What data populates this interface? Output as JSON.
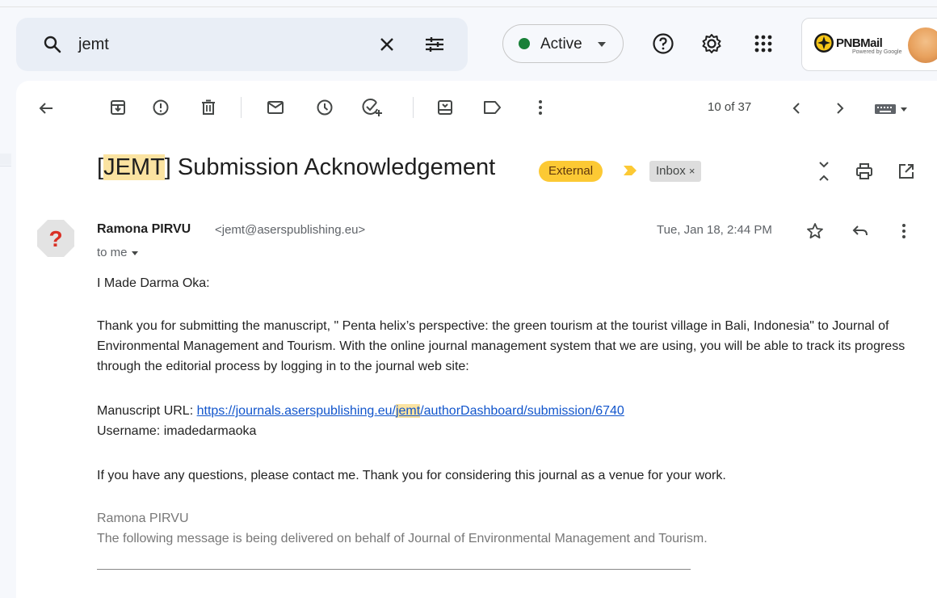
{
  "search": {
    "query": "jemt"
  },
  "status": {
    "label": "Active"
  },
  "brand": {
    "logo_text": "PNBMail",
    "powered_text": "Powered by Google"
  },
  "toolbar": {
    "pager": "10 of 37"
  },
  "email": {
    "subject_tag": "JEMT",
    "subject_rest": " Submission Acknowledgement",
    "external_label": "External",
    "inbox_label": "Inbox",
    "sender_name": "Ramona PIRVU",
    "sender_email": "<jemt@aserspublishing.eu>",
    "to_label": "to me",
    "date": "Tue, Jan 18, 2:44 PM",
    "greeting": "I Made Darma Oka:",
    "para1": "Thank you for submitting the manuscript, \" Penta helix’s perspective: the green tourism at the tourist village in Bali, Indonesia\" to Journal of Environmental Management and Tourism. With the online journal management system that we are using, you will be able to track its progress through the editorial process by logging in to the journal web site:",
    "url_label": "Manuscript URL: ",
    "url_part1": "https://journals.aserspublishing.eu/",
    "url_part2": "jemt",
    "url_part3": "/authorDashboard/submission/6740",
    "username_line": "Username: imadedarmaoka",
    "para2": "If you have any questions, please contact me. Thank you for considering this journal as a venue for your work.",
    "sig_name": "Ramona PIRVU",
    "sig_note": "The following message is being delivered on behalf of Journal of Environmental Management and Tourism."
  }
}
